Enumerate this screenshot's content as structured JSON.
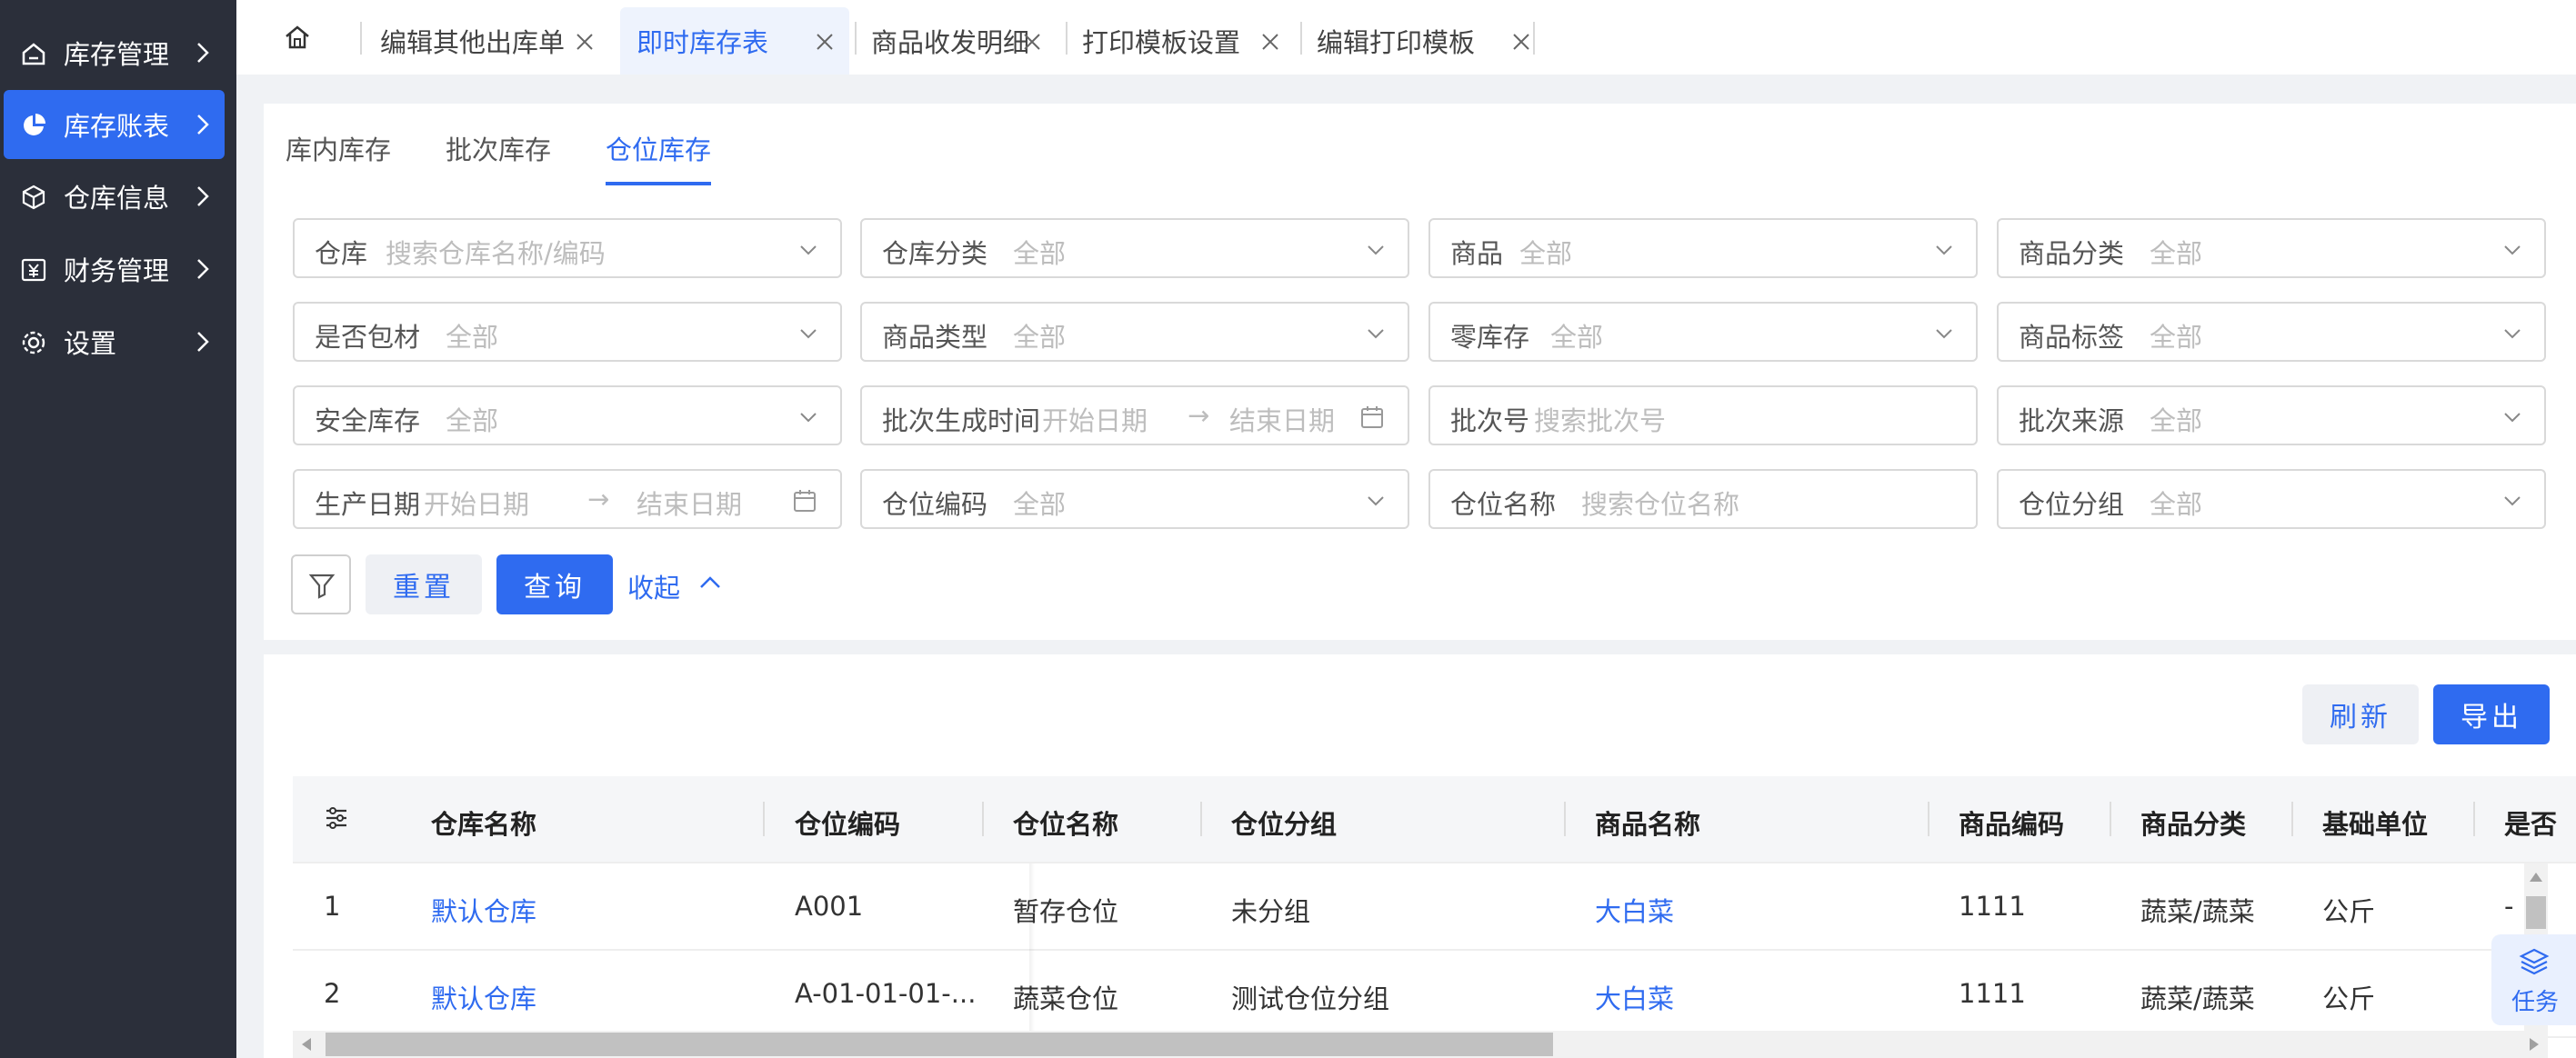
{
  "sidebar": {
    "items": [
      {
        "label": "库存管理",
        "icon": "home-icon",
        "active": false
      },
      {
        "label": "库存账表",
        "icon": "pie-chart-icon",
        "active": true
      },
      {
        "label": "仓库信息",
        "icon": "cube-icon",
        "active": false
      },
      {
        "label": "财务管理",
        "icon": "yen-icon",
        "active": false
      },
      {
        "label": "设置",
        "icon": "gear-icon",
        "active": false
      }
    ]
  },
  "tabs": {
    "home_icon": "home-icon",
    "items": [
      {
        "label": "编辑其他出库单",
        "active": false
      },
      {
        "label": "即时库存表",
        "active": true
      },
      {
        "label": "商品收发明细",
        "active": false
      },
      {
        "label": "打印模板设置",
        "active": false
      },
      {
        "label": "编辑打印模板",
        "active": false
      }
    ]
  },
  "subtabs": [
    {
      "label": "库内库存",
      "active": false
    },
    {
      "label": "批次库存",
      "active": false
    },
    {
      "label": "仓位库存",
      "active": true
    }
  ],
  "filters": {
    "warehouse": {
      "label": "仓库",
      "placeholder": "搜索仓库名称/编码"
    },
    "warehouse_category": {
      "label": "仓库分类",
      "value": "全部"
    },
    "product": {
      "label": "商品",
      "value": "全部"
    },
    "product_category": {
      "label": "商品分类",
      "value": "全部"
    },
    "is_packaging": {
      "label": "是否包材",
      "value": "全部"
    },
    "product_type": {
      "label": "商品类型",
      "value": "全部"
    },
    "zero_stock": {
      "label": "零库存",
      "value": "全部"
    },
    "product_tag": {
      "label": "商品标签",
      "value": "全部"
    },
    "safety_stock": {
      "label": "安全库存",
      "value": "全部"
    },
    "batch_time": {
      "label": "批次生成时间",
      "start": "开始日期",
      "end": "结束日期"
    },
    "batch_no": {
      "label": "批次号",
      "placeholder": "搜索批次号"
    },
    "batch_source": {
      "label": "批次来源",
      "value": "全部"
    },
    "production_date": {
      "label": "生产日期",
      "start": "开始日期",
      "end": "结束日期"
    },
    "location_code": {
      "label": "仓位编码",
      "value": "全部"
    },
    "location_name": {
      "label": "仓位名称",
      "placeholder": "搜索仓位名称"
    },
    "location_group": {
      "label": "仓位分组",
      "value": "全部"
    },
    "arrow": "→"
  },
  "actions": {
    "reset": "重置",
    "query": "查询",
    "collapse": "收起",
    "refresh": "刷新",
    "export": "导出"
  },
  "table": {
    "columns": [
      "仓库名称",
      "仓位编码",
      "仓位名称",
      "仓位分组",
      "商品名称",
      "商品编码",
      "商品分类",
      "基础单位",
      "是否"
    ],
    "rows": [
      {
        "index": "1",
        "warehouse": "默认仓库",
        "location_code": "A001",
        "location_name": "暂存仓位",
        "group": "未分组",
        "product": "大白菜",
        "product_code": "1111",
        "category": "蔬菜/蔬菜",
        "unit": "公斤",
        "extra": "-"
      },
      {
        "index": "2",
        "warehouse": "默认仓库",
        "location_code": "A-01-01-01-...",
        "location_name": "蔬菜仓位",
        "group": "测试仓位分组",
        "product": "大白菜",
        "product_code": "1111",
        "category": "蔬菜/蔬菜",
        "unit": "公斤",
        "extra": ""
      }
    ]
  },
  "task_widget": {
    "label": "任务",
    "icon": "layers-icon"
  },
  "colors": {
    "primary": "#2f6bf0",
    "sidebar_bg": "#2b2f3a"
  }
}
